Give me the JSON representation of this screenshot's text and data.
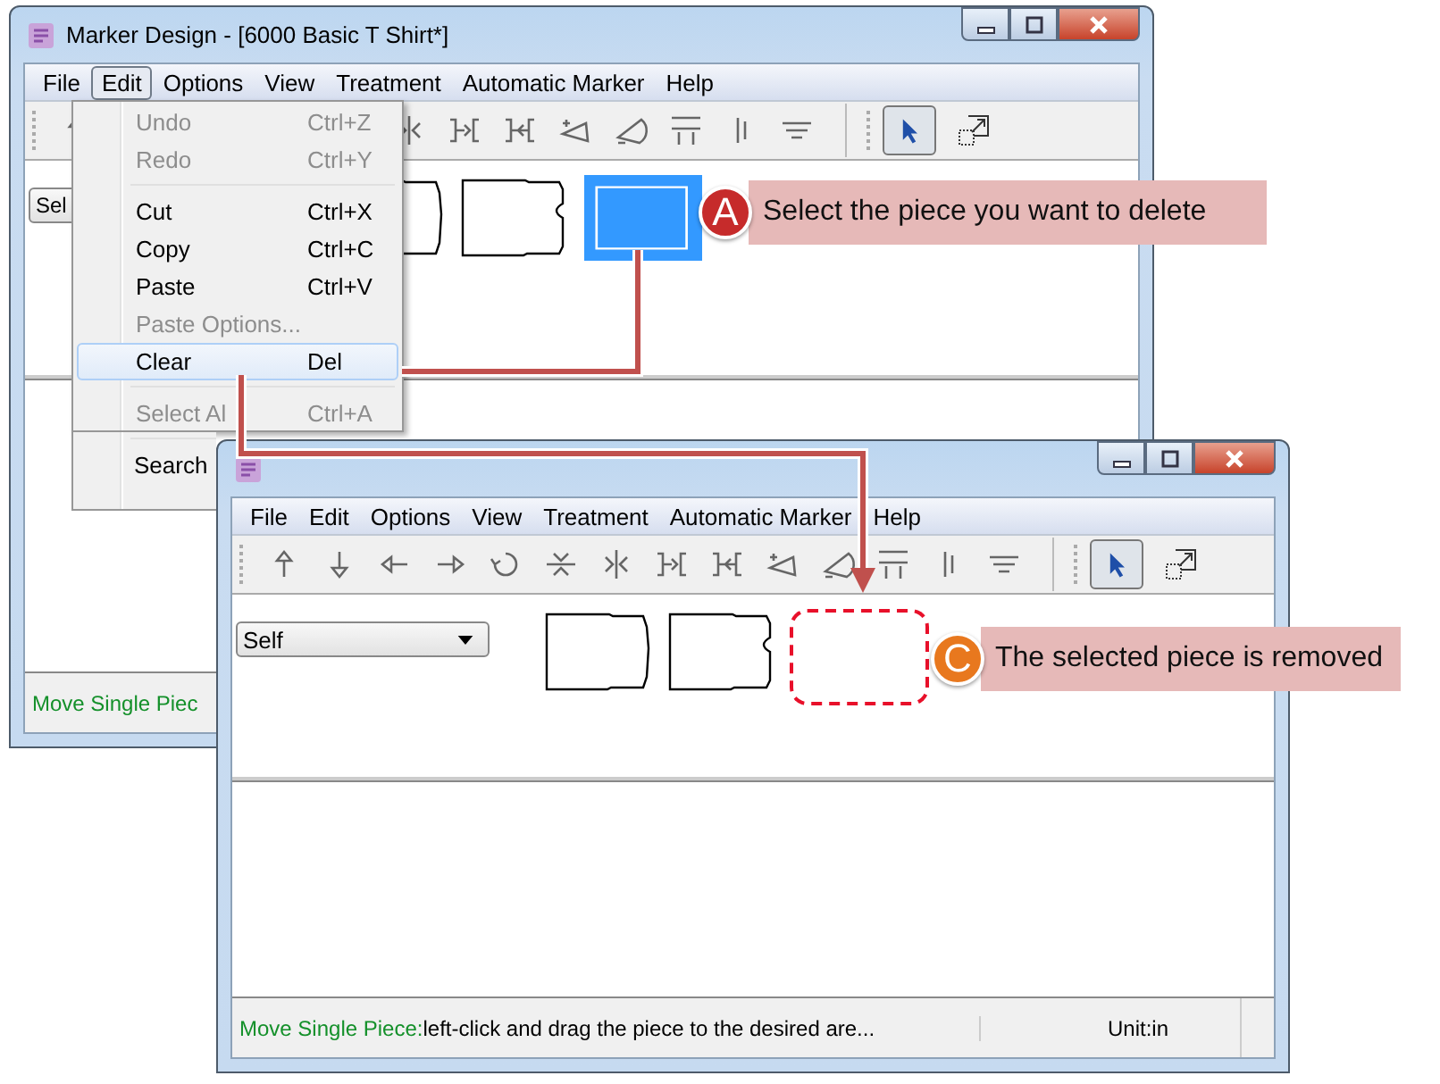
{
  "windows": [
    {
      "title": "Marker Design - [6000 Basic T Shirt*]",
      "menu": [
        {
          "label": "File",
          "selected": false
        },
        {
          "label": "Edit",
          "selected": true
        },
        {
          "label": "Options",
          "selected": false
        },
        {
          "label": "View",
          "selected": false
        },
        {
          "label": "Treatment",
          "selected": false
        },
        {
          "label": "Automatic Marker",
          "selected": false
        },
        {
          "label": "Help",
          "selected": false
        }
      ],
      "dropdown": {
        "value": "Sel"
      },
      "pieces": [
        {
          "kind": "plain",
          "selected": false
        },
        {
          "kind": "notched",
          "selected": false
        },
        {
          "kind": "plain",
          "selected": true
        }
      ],
      "status": {
        "mode": "Move Single Piec"
      }
    },
    {
      "menu": [
        {
          "label": "File",
          "selected": false
        },
        {
          "label": "Edit",
          "selected": false
        },
        {
          "label": "Options",
          "selected": false
        },
        {
          "label": "View",
          "selected": false
        },
        {
          "label": "Treatment",
          "selected": false
        },
        {
          "label": "Automatic Marker",
          "selected": false
        },
        {
          "label": "Help",
          "selected": false
        }
      ],
      "dropdown": {
        "value": "Self"
      },
      "pieces": [
        {
          "kind": "plain",
          "selected": false
        },
        {
          "kind": "notched",
          "selected": false
        },
        {
          "kind": "removed",
          "selected": false
        }
      ],
      "status": {
        "mode": "Move Single Piece:",
        "hint": "left-click and drag the piece to the desired are...",
        "unit": "Unit:in"
      }
    }
  ],
  "edit_menu": [
    {
      "kind": "item",
      "label": "Undo",
      "shortcut": "Ctrl+Z",
      "disabled": true,
      "selected": false
    },
    {
      "kind": "item",
      "label": "Redo",
      "shortcut": "Ctrl+Y",
      "disabled": true,
      "selected": false
    },
    {
      "kind": "separator"
    },
    {
      "kind": "item",
      "label": "Cut",
      "shortcut": "Ctrl+X",
      "disabled": false,
      "selected": false
    },
    {
      "kind": "item",
      "label": "Copy",
      "shortcut": "Ctrl+C",
      "disabled": false,
      "selected": false
    },
    {
      "kind": "item",
      "label": "Paste",
      "shortcut": "Ctrl+V",
      "disabled": false,
      "selected": false
    },
    {
      "kind": "item",
      "label": "Paste Options...",
      "disabled": true,
      "selected": false
    },
    {
      "kind": "item",
      "label": "Clear",
      "shortcut": "Del",
      "disabled": false,
      "selected": true
    },
    {
      "kind": "separator"
    },
    {
      "kind": "item",
      "label": "Select Al",
      "shortcut": "Ctrl+A",
      "disabled": true,
      "selected": false
    },
    {
      "kind": "separator"
    },
    {
      "kind": "item",
      "label": "Search",
      "disabled": false,
      "selected": false
    }
  ],
  "callouts": [
    {
      "badge": "A",
      "text": "Select the piece you want to delete",
      "color": "#c62b2b"
    },
    {
      "badge": "C",
      "text": "The selected piece is removed",
      "color": "#e8781e"
    }
  ]
}
